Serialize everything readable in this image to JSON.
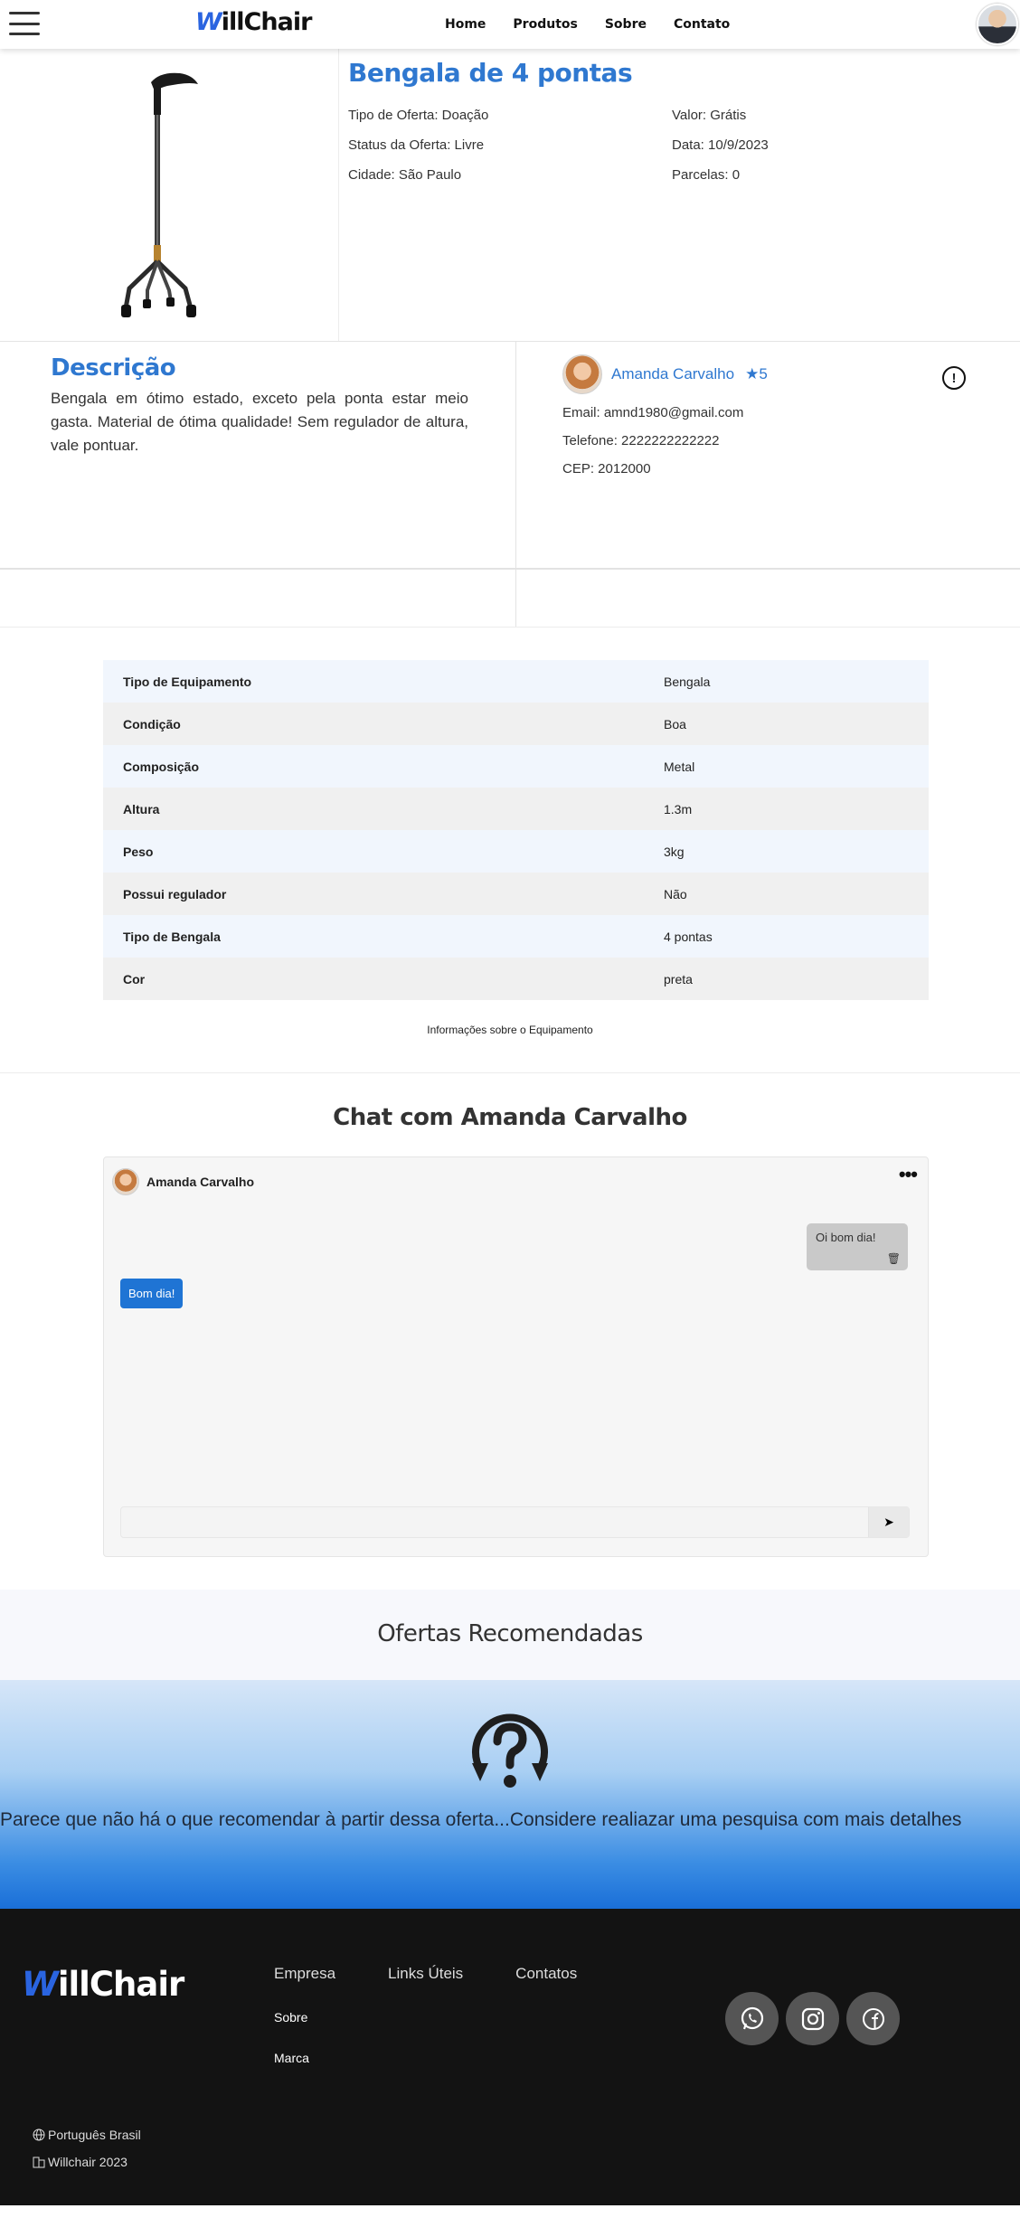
{
  "navbar": {
    "brand_w": "W",
    "brand_rest": "illChair",
    "links": [
      "Home",
      "Produtos",
      "Sobre",
      "Contato"
    ]
  },
  "product": {
    "title": "Bengala de 4 pontas",
    "offer_type": "Tipo de Oferta: Doação",
    "value": "Valor: Grátis",
    "offer_status": "Status da Oferta: Livre",
    "date": "Data: 10/9/2023",
    "city": "Cidade: São Paulo",
    "installments": "Parcelas: 0"
  },
  "description": {
    "heading": "Descrição",
    "text": "Bengala em ótimo estado, exceto pela ponta estar meio gasta. Material de ótima qualidade! Sem regulador de altura, vale pontuar."
  },
  "seller": {
    "name": "Amanda Carvalho",
    "rating": "5",
    "report_icon": "!",
    "email": "Email: amnd1980@gmail.com",
    "phone": "Telefone: 2222222222222",
    "cep": "CEP: 2012000"
  },
  "specs": {
    "rows": [
      {
        "key": "Tipo de Equipamento",
        "value": "Bengala"
      },
      {
        "key": "Condição",
        "value": "Boa"
      },
      {
        "key": "Composição",
        "value": "Metal"
      },
      {
        "key": "Altura",
        "value": "1.3m"
      },
      {
        "key": "Peso",
        "value": "3kg"
      },
      {
        "key": "Possui regulador",
        "value": "Não"
      },
      {
        "key": "Tipo de Bengala",
        "value": "4 pontas"
      },
      {
        "key": "Cor",
        "value": "preta"
      }
    ],
    "caption": "Informações sobre o Equipamento"
  },
  "chat": {
    "title": "Chat com Amanda Carvalho",
    "contact_name": "Amanda Carvalho",
    "menu_icon": "•••",
    "sent_message": "Oi bom dia!",
    "received_message": "Bom dia!",
    "input_placeholder": "",
    "send_icon": "➤",
    "trash_icon": "🗑"
  },
  "recommended": {
    "title": "Ofertas Recomendadas",
    "empty_message": "Parece que não há o que recomendar à partir dessa oferta...Considere realiazar uma pesquisa com mais detalhes"
  },
  "footer": {
    "brand_w": "W",
    "brand_rest": "illChair",
    "columns": [
      "Empresa",
      "Links Úteis",
      "Contatos"
    ],
    "links": [
      "Sobre",
      "Marca"
    ],
    "social_icons": [
      "whatsapp-icon",
      "instagram-icon",
      "facebook-icon"
    ],
    "language": "Português Brasil",
    "copyright": "Willchair 2023"
  }
}
